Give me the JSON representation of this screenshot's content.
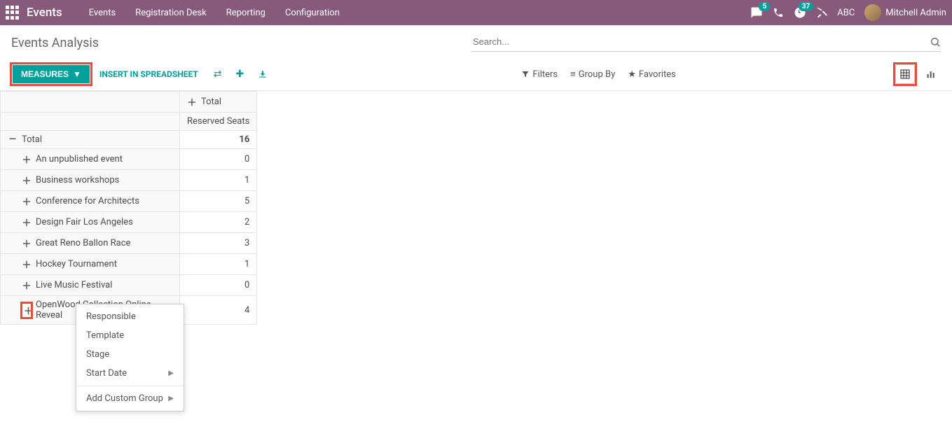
{
  "topbar": {
    "brand": "Events",
    "nav": [
      "Events",
      "Registration Desk",
      "Reporting",
      "Configuration"
    ],
    "msg_badge": "5",
    "clock_badge": "37",
    "company": "ABC",
    "user": "Mitchell Admin"
  },
  "page": {
    "title": "Events Analysis",
    "search_placeholder": "Search..."
  },
  "toolbar": {
    "measures": "MEASURES",
    "insert": "INSERT IN SPREADSHEET",
    "filters": "Filters",
    "group_by": "Group By",
    "favorites": "Favorites"
  },
  "pivot": {
    "col_total": "Total",
    "measure_label": "Reserved Seats",
    "row_total_label": "Total",
    "row_total_value": "16",
    "rows": [
      {
        "label": "An unpublished event",
        "value": "0"
      },
      {
        "label": "Business workshops",
        "value": "1"
      },
      {
        "label": "Conference for Architects",
        "value": "5"
      },
      {
        "label": "Design Fair Los Angeles",
        "value": "2"
      },
      {
        "label": "Great Reno Ballon Race",
        "value": "3"
      },
      {
        "label": "Hockey Tournament",
        "value": "1"
      },
      {
        "label": "Live Music Festival",
        "value": "0"
      },
      {
        "label": "OpenWood Collection Online Reveal",
        "value": "4"
      }
    ]
  },
  "dropdown": {
    "items": [
      "Responsible",
      "Template",
      "Stage",
      "Start Date"
    ],
    "custom": "Add Custom Group"
  }
}
